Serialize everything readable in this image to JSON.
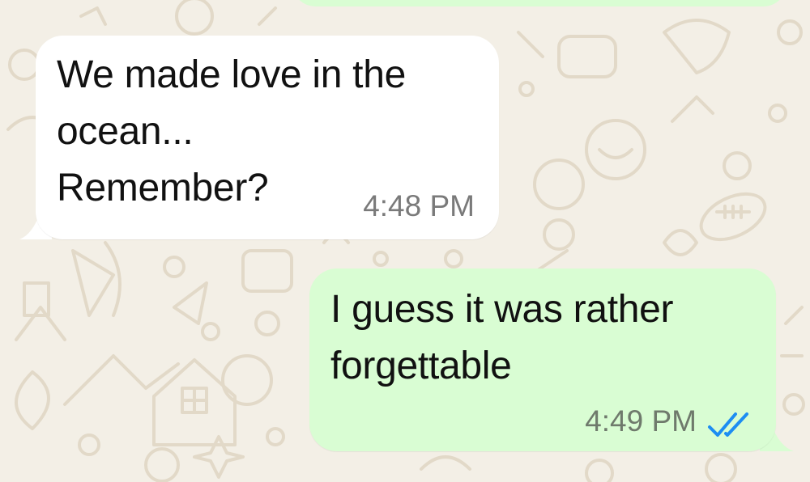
{
  "chat": {
    "messages": [
      {
        "direction": "incoming",
        "text": "We made love in the\nocean...\nRemember?",
        "time": "4:48 PM"
      },
      {
        "direction": "outgoing",
        "text": "I guess it was rather\nforgettable",
        "time": "4:49 PM",
        "read_status": "double-check-icon"
      }
    ]
  },
  "colors": {
    "wallpaper": "#f3efe6",
    "incoming_bubble": "#ffffff",
    "outgoing_bubble": "#d9fdd3",
    "read_ticks": "#1d8df2"
  }
}
